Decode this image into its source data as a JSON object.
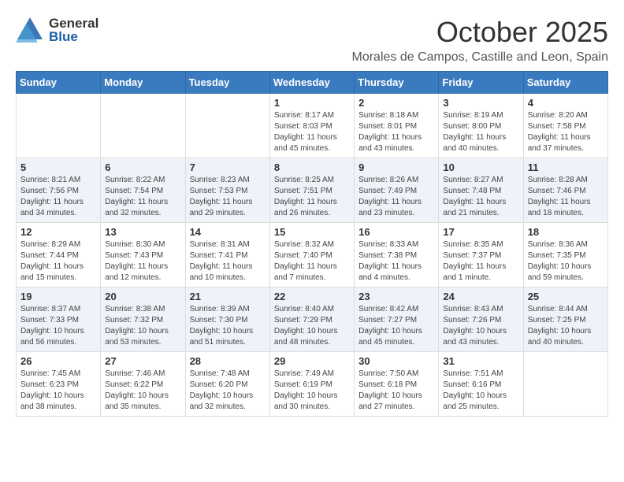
{
  "logo": {
    "general": "General",
    "blue": "Blue"
  },
  "title": "October 2025",
  "subtitle": "Morales de Campos, Castille and Leon, Spain",
  "days_of_week": [
    "Sunday",
    "Monday",
    "Tuesday",
    "Wednesday",
    "Thursday",
    "Friday",
    "Saturday"
  ],
  "weeks": [
    [
      {
        "day": "",
        "info": ""
      },
      {
        "day": "",
        "info": ""
      },
      {
        "day": "",
        "info": ""
      },
      {
        "day": "1",
        "info": "Sunrise: 8:17 AM\nSunset: 8:03 PM\nDaylight: 11 hours\nand 45 minutes."
      },
      {
        "day": "2",
        "info": "Sunrise: 8:18 AM\nSunset: 8:01 PM\nDaylight: 11 hours\nand 43 minutes."
      },
      {
        "day": "3",
        "info": "Sunrise: 8:19 AM\nSunset: 8:00 PM\nDaylight: 11 hours\nand 40 minutes."
      },
      {
        "day": "4",
        "info": "Sunrise: 8:20 AM\nSunset: 7:58 PM\nDaylight: 11 hours\nand 37 minutes."
      }
    ],
    [
      {
        "day": "5",
        "info": "Sunrise: 8:21 AM\nSunset: 7:56 PM\nDaylight: 11 hours\nand 34 minutes."
      },
      {
        "day": "6",
        "info": "Sunrise: 8:22 AM\nSunset: 7:54 PM\nDaylight: 11 hours\nand 32 minutes."
      },
      {
        "day": "7",
        "info": "Sunrise: 8:23 AM\nSunset: 7:53 PM\nDaylight: 11 hours\nand 29 minutes."
      },
      {
        "day": "8",
        "info": "Sunrise: 8:25 AM\nSunset: 7:51 PM\nDaylight: 11 hours\nand 26 minutes."
      },
      {
        "day": "9",
        "info": "Sunrise: 8:26 AM\nSunset: 7:49 PM\nDaylight: 11 hours\nand 23 minutes."
      },
      {
        "day": "10",
        "info": "Sunrise: 8:27 AM\nSunset: 7:48 PM\nDaylight: 11 hours\nand 21 minutes."
      },
      {
        "day": "11",
        "info": "Sunrise: 8:28 AM\nSunset: 7:46 PM\nDaylight: 11 hours\nand 18 minutes."
      }
    ],
    [
      {
        "day": "12",
        "info": "Sunrise: 8:29 AM\nSunset: 7:44 PM\nDaylight: 11 hours\nand 15 minutes."
      },
      {
        "day": "13",
        "info": "Sunrise: 8:30 AM\nSunset: 7:43 PM\nDaylight: 11 hours\nand 12 minutes."
      },
      {
        "day": "14",
        "info": "Sunrise: 8:31 AM\nSunset: 7:41 PM\nDaylight: 11 hours\nand 10 minutes."
      },
      {
        "day": "15",
        "info": "Sunrise: 8:32 AM\nSunset: 7:40 PM\nDaylight: 11 hours\nand 7 minutes."
      },
      {
        "day": "16",
        "info": "Sunrise: 8:33 AM\nSunset: 7:38 PM\nDaylight: 11 hours\nand 4 minutes."
      },
      {
        "day": "17",
        "info": "Sunrise: 8:35 AM\nSunset: 7:37 PM\nDaylight: 11 hours\nand 1 minute."
      },
      {
        "day": "18",
        "info": "Sunrise: 8:36 AM\nSunset: 7:35 PM\nDaylight: 10 hours\nand 59 minutes."
      }
    ],
    [
      {
        "day": "19",
        "info": "Sunrise: 8:37 AM\nSunset: 7:33 PM\nDaylight: 10 hours\nand 56 minutes."
      },
      {
        "day": "20",
        "info": "Sunrise: 8:38 AM\nSunset: 7:32 PM\nDaylight: 10 hours\nand 53 minutes."
      },
      {
        "day": "21",
        "info": "Sunrise: 8:39 AM\nSunset: 7:30 PM\nDaylight: 10 hours\nand 51 minutes."
      },
      {
        "day": "22",
        "info": "Sunrise: 8:40 AM\nSunset: 7:29 PM\nDaylight: 10 hours\nand 48 minutes."
      },
      {
        "day": "23",
        "info": "Sunrise: 8:42 AM\nSunset: 7:27 PM\nDaylight: 10 hours\nand 45 minutes."
      },
      {
        "day": "24",
        "info": "Sunrise: 8:43 AM\nSunset: 7:26 PM\nDaylight: 10 hours\nand 43 minutes."
      },
      {
        "day": "25",
        "info": "Sunrise: 8:44 AM\nSunset: 7:25 PM\nDaylight: 10 hours\nand 40 minutes."
      }
    ],
    [
      {
        "day": "26",
        "info": "Sunrise: 7:45 AM\nSunset: 6:23 PM\nDaylight: 10 hours\nand 38 minutes."
      },
      {
        "day": "27",
        "info": "Sunrise: 7:46 AM\nSunset: 6:22 PM\nDaylight: 10 hours\nand 35 minutes."
      },
      {
        "day": "28",
        "info": "Sunrise: 7:48 AM\nSunset: 6:20 PM\nDaylight: 10 hours\nand 32 minutes."
      },
      {
        "day": "29",
        "info": "Sunrise: 7:49 AM\nSunset: 6:19 PM\nDaylight: 10 hours\nand 30 minutes."
      },
      {
        "day": "30",
        "info": "Sunrise: 7:50 AM\nSunset: 6:18 PM\nDaylight: 10 hours\nand 27 minutes."
      },
      {
        "day": "31",
        "info": "Sunrise: 7:51 AM\nSunset: 6:16 PM\nDaylight: 10 hours\nand 25 minutes."
      },
      {
        "day": "",
        "info": ""
      }
    ]
  ]
}
